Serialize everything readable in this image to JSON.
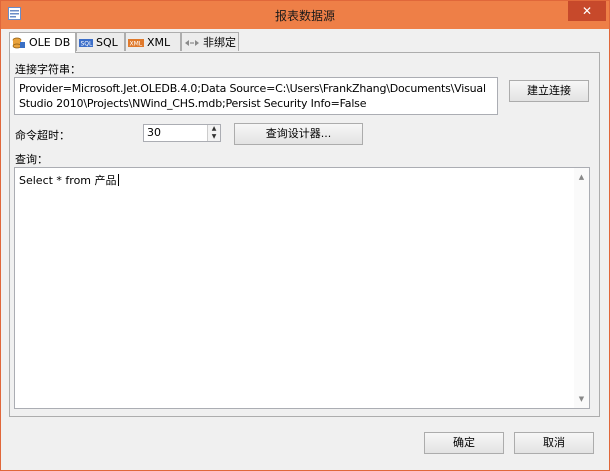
{
  "window": {
    "title": "报表数据源",
    "close_glyph": "✕"
  },
  "tabs": [
    {
      "label": "OLE DB",
      "icon": "database-icon"
    },
    {
      "label": "SQL",
      "icon": "sql-icon"
    },
    {
      "label": "XML",
      "icon": "xml-icon"
    },
    {
      "label": "非绑定",
      "icon": "unbound-icon"
    }
  ],
  "connection": {
    "label": "连接字符串：",
    "value": "Provider=Microsoft.Jet.OLEDB.4.0;Data Source=C:\\Users\\FrankZhang\\Documents\\Visual Studio 2010\\Projects\\NWind_CHS.mdb;Persist Security Info=False",
    "connect_button": "建立连接"
  },
  "timeout": {
    "label": "命令超时：",
    "value": "30"
  },
  "designer_button": "查询设计器...",
  "query": {
    "label": "查询：",
    "value": "Select * from 产品"
  },
  "footer": {
    "ok": "确定",
    "cancel": "取消"
  },
  "colors": {
    "titlebar": "#ee7f47",
    "close": "#c7492b",
    "border": "#e0673a"
  }
}
